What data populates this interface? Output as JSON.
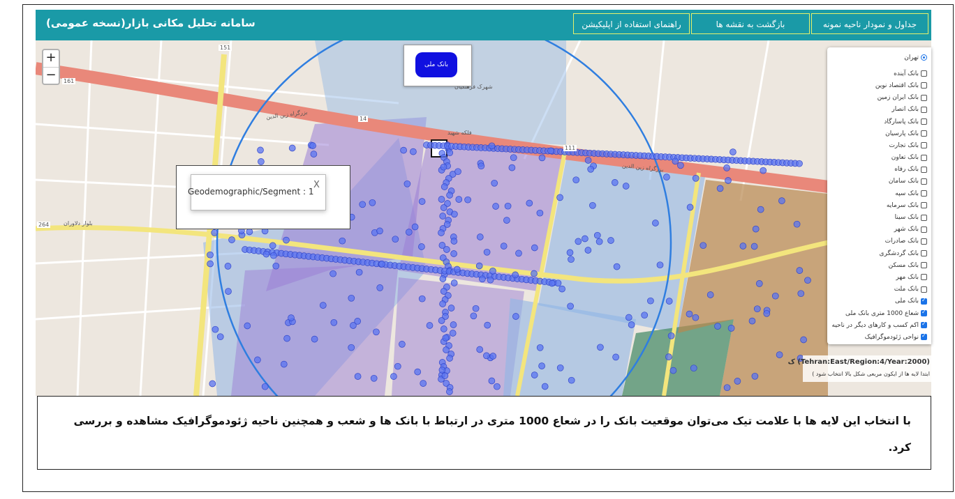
{
  "header": {
    "app_title": "سامانه تحلیل مکانی بازار(نسخه عمومی)",
    "buttons": [
      "جداول و نمودار ناحیه نمونه",
      "بازگشت به نقشه ها",
      "راهنمای استفاده از اپلیکیشن"
    ]
  },
  "map": {
    "zoom_in": "+",
    "zoom_out": "−",
    "bank_popup": "بانک ملی",
    "segment_popup": {
      "text": "Geodemographic/Segment : 1",
      "close": "X"
    },
    "street_labels": [
      "بزرگراه زین الدین",
      "بلوار دلاوران",
      "فلکه شهید",
      "شهرک فرهنگیان",
      "151",
      "161",
      "264",
      "14",
      "111"
    ],
    "region_info": {
      "title": "(Tehran:East/Region:4/Year:2000) ک",
      "hint": "ابتدا لایه ها از ایکون مربعی شکل بالا انتخاب شود )"
    }
  },
  "layers_panel": {
    "base": "تهران",
    "items": [
      {
        "label": "بانک آینده",
        "checked": false
      },
      {
        "label": "بانک اقتصاد نوین",
        "checked": false
      },
      {
        "label": "بانک ایران زمین",
        "checked": false
      },
      {
        "label": "بانک انصار",
        "checked": false
      },
      {
        "label": "بانک پاسارگاد",
        "checked": false
      },
      {
        "label": "بانک پارسیان",
        "checked": false
      },
      {
        "label": "بانک تجارت",
        "checked": false
      },
      {
        "label": "بانک تعاون",
        "checked": false
      },
      {
        "label": "بانک رفاه",
        "checked": false
      },
      {
        "label": "بانک سامان",
        "checked": false
      },
      {
        "label": "بانک سپه",
        "checked": false
      },
      {
        "label": "بانک سرمایه",
        "checked": false
      },
      {
        "label": "بانک سینا",
        "checked": false
      },
      {
        "label": "بانک شهر",
        "checked": false
      },
      {
        "label": "بانک صادرات",
        "checked": false
      },
      {
        "label": "بانک گردشگری",
        "checked": false
      },
      {
        "label": "بانک مسکن",
        "checked": false
      },
      {
        "label": "بانک مهر",
        "checked": false
      },
      {
        "label": "بانک ملت",
        "checked": false
      },
      {
        "label": "بانک ملی",
        "checked": true
      },
      {
        "label": "شعاع 1000 متری بانک ملی",
        "checked": true
      },
      {
        "label": "اکم کسب و کارهای دیگر در ناحیه",
        "checked": true
      },
      {
        "label": "نواحی ژئودموگرافیک",
        "checked": true
      }
    ]
  },
  "caption": "با انتخاب این لایه ها با علامت تیک می‌توان موقعیت بانک را در شعاع 1000 متری در ارتباط با بانک ها و شعب و همچنین ناحیه ژئودموگرافیک مشاهده و بررسی کرد.",
  "colors": {
    "header": "#1a9aa7",
    "segment_purple": "#9b7fd6",
    "segment_blue": "#8fb5e6",
    "segment_brown": "#b8874f",
    "segment_green": "#4a8e6b",
    "bank_marker": "#4f6ef0"
  }
}
